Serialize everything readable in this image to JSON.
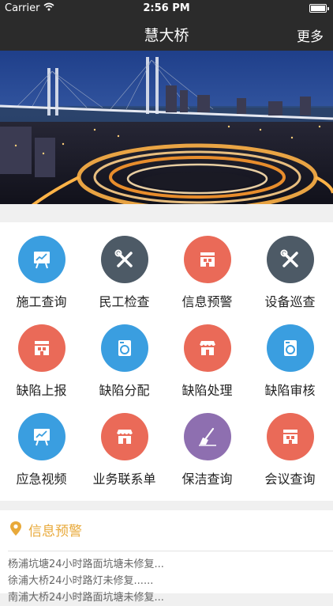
{
  "status_bar": {
    "carrier": "Carrier",
    "time": "2:56 PM"
  },
  "nav": {
    "title": "慧大桥",
    "more_label": "更多"
  },
  "grid": [
    {
      "label": "施工查询",
      "color": "#3a9ee0",
      "icon": "presentation-icon"
    },
    {
      "label": "民工检查",
      "color": "#4d5a66",
      "icon": "tools-icon"
    },
    {
      "label": "信息预警",
      "color": "#ea6a58",
      "icon": "building-icon"
    },
    {
      "label": "设备巡查",
      "color": "#4d5a66",
      "icon": "tools-icon"
    },
    {
      "label": "缺陷上报",
      "color": "#ea6a58",
      "icon": "building-icon"
    },
    {
      "label": "缺陷分配",
      "color": "#3a9ee0",
      "icon": "washing-machine-icon"
    },
    {
      "label": "缺陷处理",
      "color": "#ea6a58",
      "icon": "shop-icon"
    },
    {
      "label": "缺陷审核",
      "color": "#3a9ee0",
      "icon": "washing-machine-icon"
    },
    {
      "label": "应急视频",
      "color": "#3a9ee0",
      "icon": "presentation-icon"
    },
    {
      "label": "业务联系单",
      "color": "#ea6a58",
      "icon": "shop-icon"
    },
    {
      "label": "保洁查询",
      "color": "#8e6fb0",
      "icon": "broom-icon"
    },
    {
      "label": "会议查询",
      "color": "#ea6a58",
      "icon": "building-icon"
    }
  ],
  "info_panel": {
    "title": "信息预警",
    "accent_color": "#e8a93a",
    "items": [
      "杨浦坑塘24小时路面坑塘未修复...",
      "徐浦大桥24小时路灯未修复......",
      "南浦大桥24小时路面坑塘未修复..."
    ]
  }
}
